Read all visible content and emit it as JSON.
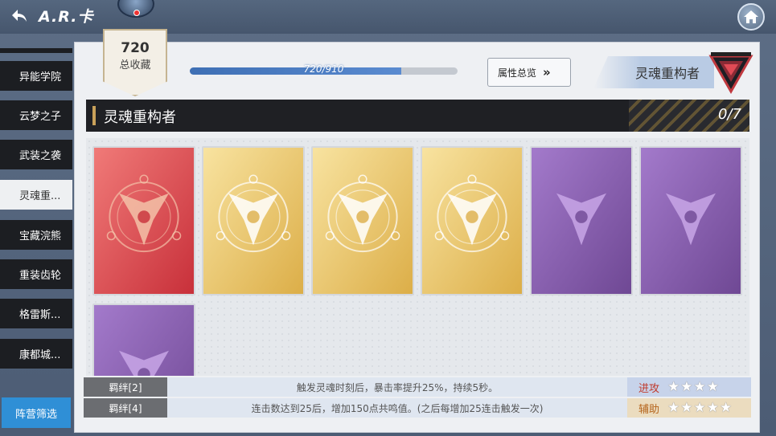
{
  "header": {
    "title": "A.R.卡",
    "back_icon": "back-arrow-icon",
    "home_icon": "home-icon"
  },
  "sidebar": {
    "items": [
      {
        "label": "异能学院"
      },
      {
        "label": "云梦之子"
      },
      {
        "label": "武装之袭"
      },
      {
        "label": "灵魂重...",
        "active": true
      },
      {
        "label": "宝藏浣熊"
      },
      {
        "label": "重装齿轮"
      },
      {
        "label": "格雷斯..."
      },
      {
        "label": "康都城..."
      }
    ],
    "filter_label": "阵营筛选"
  },
  "collection": {
    "count": "720",
    "label": "总收藏",
    "progress_text": "720/910",
    "progress": 0.791
  },
  "attr_button": {
    "label": "属性总览",
    "icon": "double-chevron-right-icon"
  },
  "set": {
    "name": "灵魂重构者",
    "title": "灵魂重构者",
    "count": "0/7"
  },
  "cards": [
    {
      "rarity": "red"
    },
    {
      "rarity": "gold"
    },
    {
      "rarity": "gold"
    },
    {
      "rarity": "gold"
    },
    {
      "rarity": "purple"
    },
    {
      "rarity": "purple"
    },
    {
      "rarity": "purple"
    }
  ],
  "bonuses": [
    {
      "tag": "羁绊[2]",
      "desc": "触发灵魂时刻后，暴击率提升25%，持续5秒。"
    },
    {
      "tag": "羁绊[4]",
      "desc": "连击数达到25后，增加150点共鸣值。(之后每增加25连击触发一次)"
    }
  ],
  "ratings": [
    {
      "label": "进攻",
      "stars": "★★★★"
    },
    {
      "label": "辅助",
      "stars": "★★★★★"
    }
  ],
  "colors": {
    "accent_blue": "#2f8fd6",
    "sidebar_dark": "#1c1e22",
    "card_red": "#d94a4f",
    "card_gold": "#e8c66a",
    "card_purple": "#8a5fb0"
  }
}
